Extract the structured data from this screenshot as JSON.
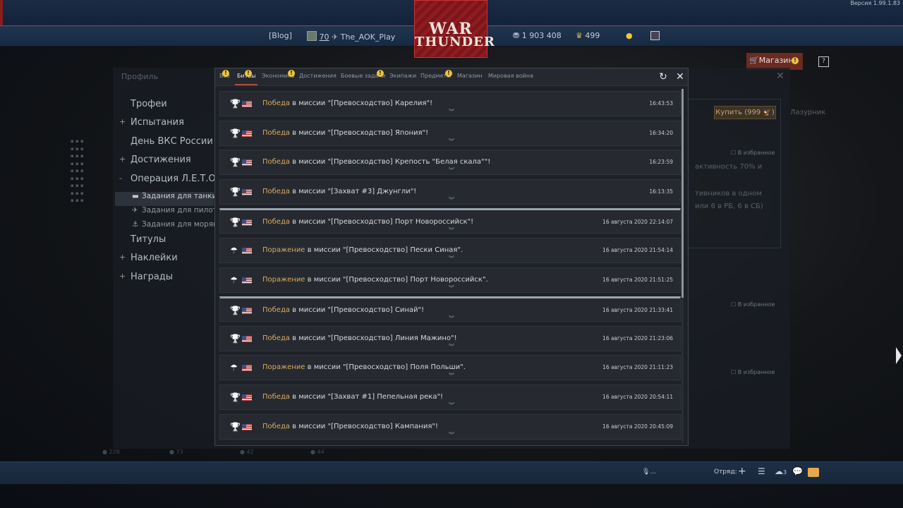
{
  "version": "Версия 1.99.1.83",
  "topbar": {
    "blog": "[Blog]",
    "level": "70",
    "username": "The_AOK_Play",
    "silver": "1 903 408",
    "gold": "499",
    "shop": "Магазин",
    "help": "?"
  },
  "logo": {
    "line1": "WAR",
    "line2": "THUNDER"
  },
  "sidemenu": [
    {
      "label": "Трофеи",
      "prefix": "",
      "type": "main"
    },
    {
      "label": "Испытания",
      "prefix": "+",
      "type": "main"
    },
    {
      "label": "День ВКС России",
      "prefix": "",
      "type": "main"
    },
    {
      "label": "Достижения",
      "prefix": "+",
      "type": "main"
    },
    {
      "label": "Операция Л.Е.Т.О.",
      "prefix": "-",
      "type": "main"
    },
    {
      "label": "Задания для танки",
      "prefix": "",
      "type": "sub-selected"
    },
    {
      "label": "Задания для пилото",
      "prefix": "",
      "type": "sub"
    },
    {
      "label": "Задания для моряк",
      "prefix": "",
      "type": "sub"
    },
    {
      "label": "Титулы",
      "prefix": "",
      "type": "main"
    },
    {
      "label": "Наклейки",
      "prefix": "+",
      "type": "main"
    },
    {
      "label": "Награды",
      "prefix": "+",
      "type": "main"
    }
  ],
  "behind": {
    "profile_tab": "Профиль",
    "buy_button": "Купить (999 🦅)",
    "favorite": "В избранное",
    "text1": "активность 70% и",
    "text2": "тивников в одном",
    "text3": "или 6 в РБ, 6 в СБ)",
    "right_label": "Лазурник"
  },
  "dialog": {
    "tabs": [
      {
        "label": "Все",
        "badge": true
      },
      {
        "label": "Битвы",
        "badge": true,
        "active": true
      },
      {
        "label": "Экономика",
        "badge": false
      },
      {
        "label": "Достижения",
        "badge": true
      },
      {
        "label": "Боевые задачи",
        "badge": false
      },
      {
        "label": "Экипажи",
        "badge": true
      },
      {
        "label": "Предметы",
        "badge": false
      },
      {
        "label": "Магазин",
        "badge": true
      },
      {
        "label": "Мировая война",
        "badge": false
      }
    ],
    "refresh_icon": "refresh-icon",
    "close_icon": "close-icon"
  },
  "battles": [
    {
      "result": "Победа",
      "mission": " в миссии \"[Превосходство] Карелия\"!",
      "time": "16:43:53",
      "icon": "trophy",
      "sep": false
    },
    {
      "result": "Победа",
      "mission": " в миссии \"[Превосходство] Япония\"!",
      "time": "16:34:20",
      "icon": "trophy",
      "sep": false
    },
    {
      "result": "Победа",
      "mission": " в миссии \"[Превосходство] Крепость \"Белая скала\"\"!",
      "time": "16:23:59",
      "icon": "trophy",
      "sep": false
    },
    {
      "result": "Победа",
      "mission": " в миссии \"[Захват #3] Джунгли\"!",
      "time": "16:13:35",
      "icon": "trophy",
      "sep": false
    },
    {
      "result": "Победа",
      "mission": " в миссии \"[Превосходство] Порт Новороссийск\"!",
      "time": "16 августа 2020 22:14:07",
      "icon": "trophy",
      "sep": true
    },
    {
      "result": "Поражение",
      "mission": " в миссии \"[Превосходство] Пески Синая\".",
      "time": "16 августа 2020 21:54:14",
      "icon": "parachute",
      "sep": false
    },
    {
      "result": "Поражение",
      "mission": " в миссии \"[Превосходство] Порт Новороссийск\".",
      "time": "16 августа 2020 21:51:25",
      "icon": "parachute",
      "sep": false
    },
    {
      "result": "Победа",
      "mission": " в миссии \"[Превосходство] Синай\"!",
      "time": "16 августа 2020 21:33:41",
      "icon": "trophy",
      "sep": true
    },
    {
      "result": "Победа",
      "mission": " в миссии \"[Превосходство] Линия Мажино\"!",
      "time": "16 августа 2020 21:23:06",
      "icon": "trophy",
      "sep": false
    },
    {
      "result": "Поражение",
      "mission": " в миссии \"[Превосходство] Поля Польши\".",
      "time": "16 августа 2020 21:11:23",
      "icon": "parachute",
      "sep": false
    },
    {
      "result": "Победа",
      "mission": " в миссии \"[Захват #1] Пепельная река\"!",
      "time": "16 августа 2020 20:54:11",
      "icon": "trophy",
      "sep": false
    },
    {
      "result": "Победа",
      "mission": " в миссии \"[Превосходство] Кампания\"!",
      "time": "16 августа 2020 20:45:09",
      "icon": "trophy",
      "sep": false
    }
  ],
  "bottombar": {
    "voice": "...",
    "squad": "Отряд:",
    "count": "3"
  }
}
